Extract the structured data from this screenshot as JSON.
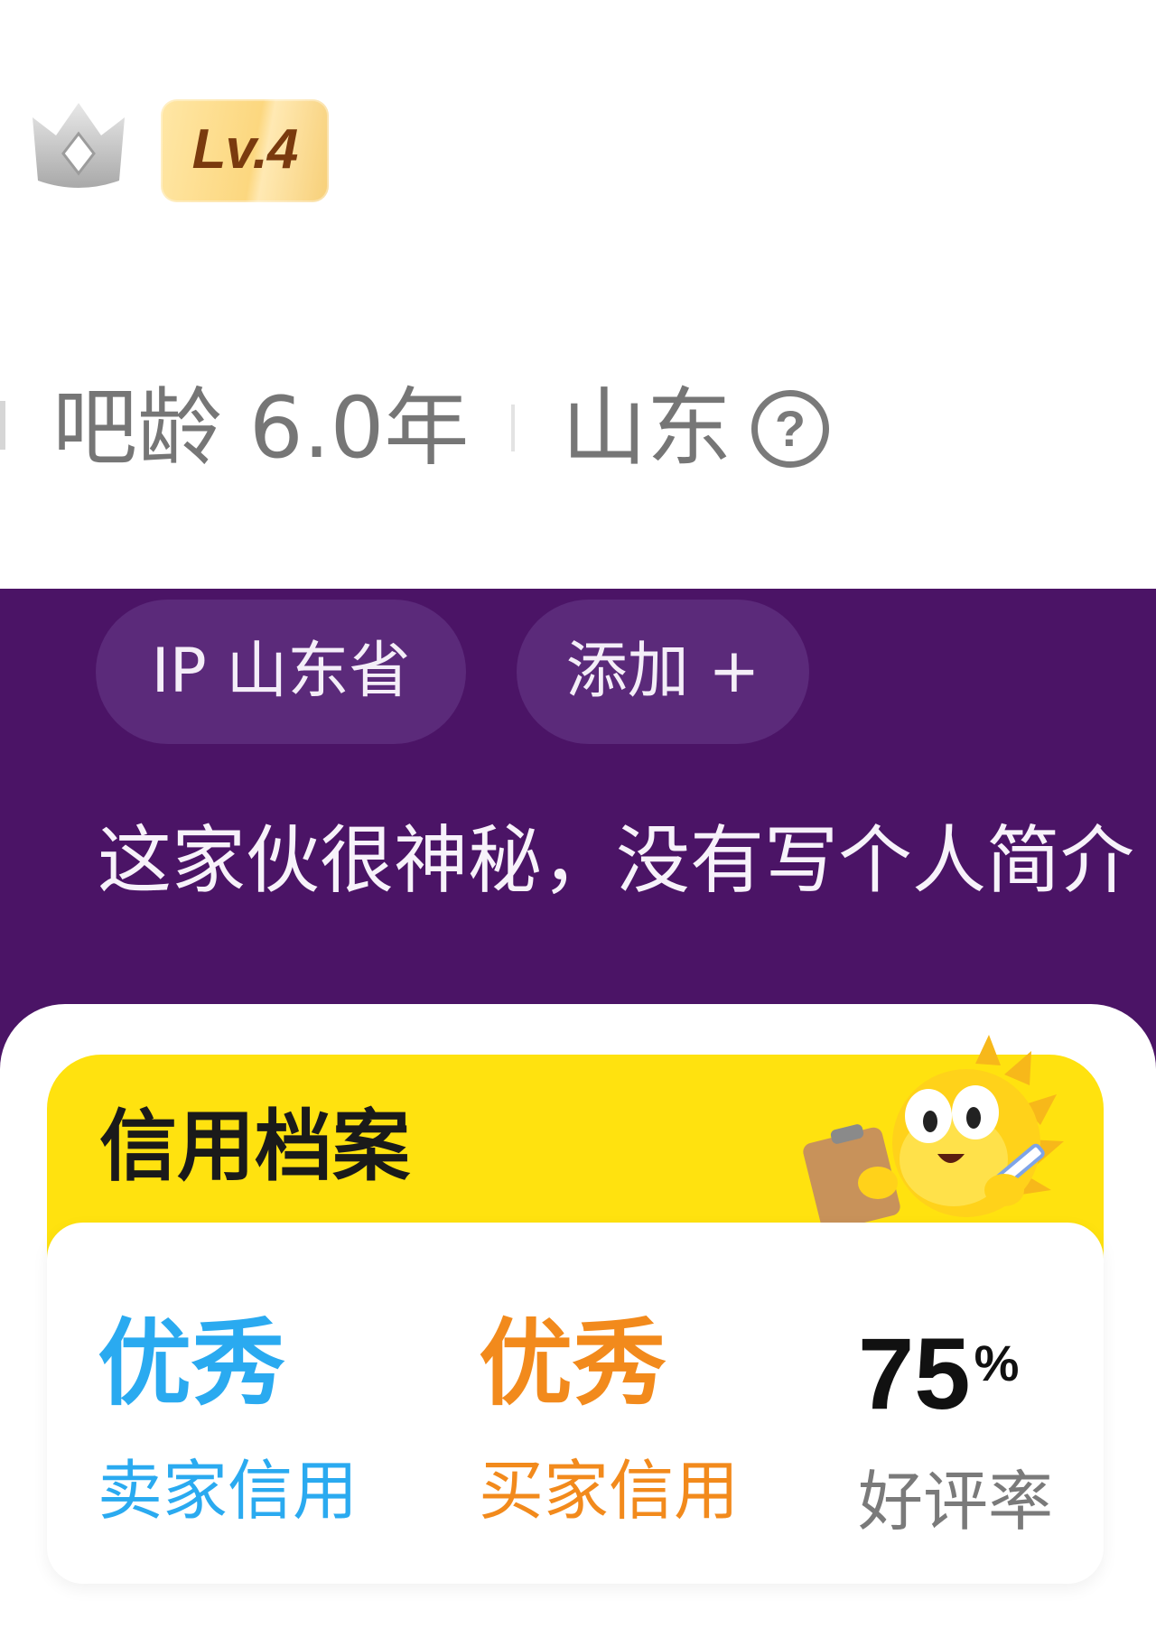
{
  "profile": {
    "level_label": "Lv.4",
    "age_text": "吧龄 6.0年",
    "location_text": "山东",
    "help_glyph": "?"
  },
  "tags": {
    "ip_label": "IP 山东省",
    "add_label": "添加 +"
  },
  "bio": "这家伙很神秘，没有写个人简介",
  "credit": {
    "title": "信用档案",
    "seller_rating": "优秀",
    "seller_label": "卖家信用",
    "buyer_rating": "优秀",
    "buyer_label": "买家信用",
    "positive_rate": "75",
    "positive_rate_unit": "%",
    "positive_rate_label": "好评率"
  },
  "colors": {
    "purple_band": "#4b1466",
    "chip": "#5b2a7a",
    "card_yellow": "#ffe20f",
    "seller_blue": "#2aaaf0",
    "buyer_orange": "#f28a1c"
  },
  "icons": [
    "crown-icon",
    "help-icon",
    "mascot-illustration"
  ]
}
